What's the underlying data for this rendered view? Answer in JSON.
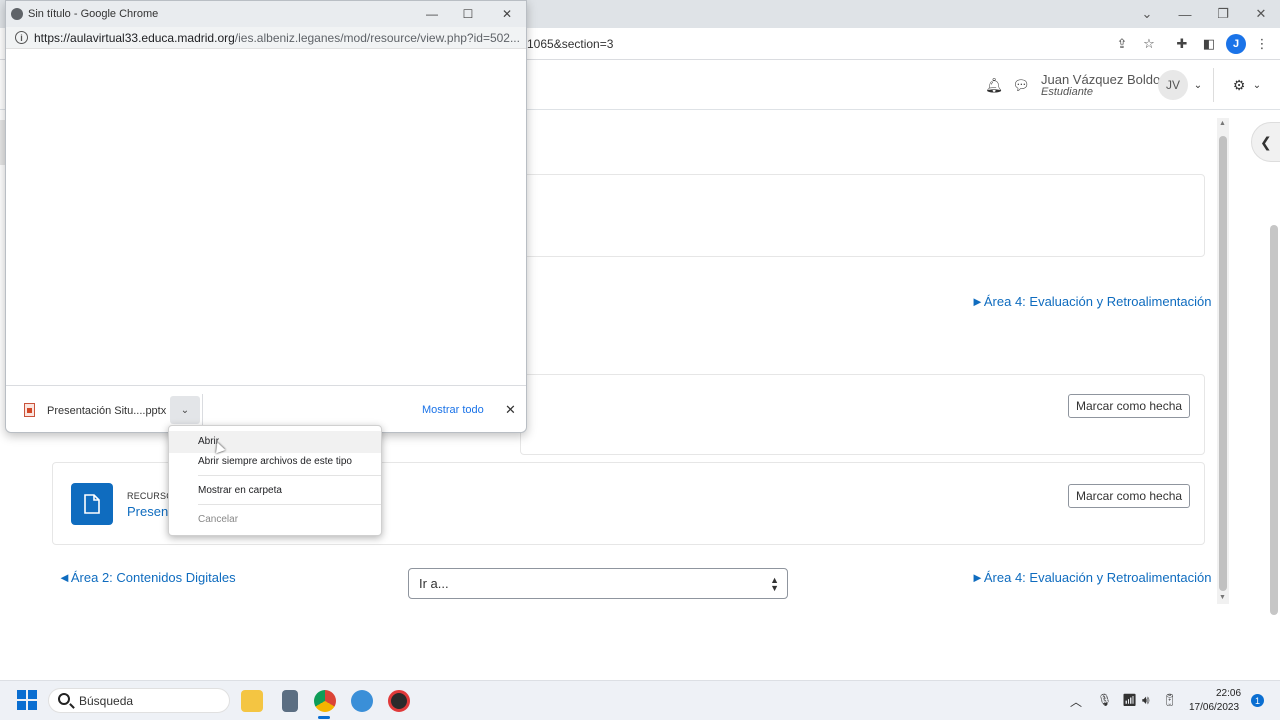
{
  "background_browser": {
    "url_tail": "1065&section=3"
  },
  "navbar": {
    "user_name": "Juan Vázquez Boldo",
    "user_role": "Estudiante",
    "avatar_initials": "JV",
    "profile_initial": "J"
  },
  "content": {
    "next_section_top": "►Área 4: Evaluación y Retroalimentación",
    "mark_done_1": "Marcar como hecha",
    "mark_done_2": "Marcar como hecha",
    "resource_type": "RECURSO",
    "resource_title": "Present",
    "prev_section": "◄Área 2: Contenidos Digitales",
    "jump_to": "Ir a...",
    "next_section_bottom": "►Área 4: Evaluación y Retroalimentación"
  },
  "popup": {
    "title": "Sin título - Google Chrome",
    "url_host": "https://aulavirtual33.educa.madrid.org",
    "url_path": "/ies.albeniz.leganes/mod/resource/view.php?id=502..."
  },
  "download_bar": {
    "file_name": "Presentación Situ....pptx",
    "show_all": "Mostrar todo"
  },
  "context_menu": {
    "items": [
      {
        "label": "Abrir"
      },
      {
        "label": "Abrir siempre archivos de este tipo"
      },
      {
        "label": "Mostrar en carpeta"
      },
      {
        "label": "Cancelar"
      }
    ]
  },
  "taskbar": {
    "search_placeholder": "Búsqueda",
    "time": "22:06",
    "date": "17/06/2023",
    "notification_count": "1"
  },
  "colors": {
    "link": "#0f6cbf",
    "accent": "#1a73e8",
    "taskbar": "#eef1f6"
  }
}
